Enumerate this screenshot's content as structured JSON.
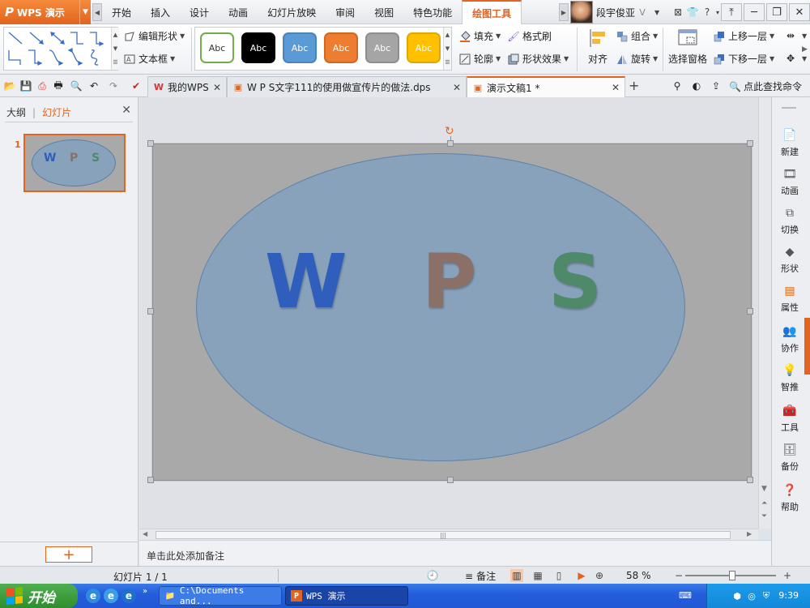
{
  "app": {
    "name": "WPS 演示",
    "logo_glyph": "P"
  },
  "menu": {
    "tabs": [
      "开始",
      "插入",
      "设计",
      "动画",
      "幻灯片放映",
      "审阅",
      "视图",
      "特色功能",
      "绘图工具"
    ],
    "active_tab": "绘图工具"
  },
  "user": {
    "name": "段宇俊亚"
  },
  "ribbon": {
    "edit_shape": "编辑形状",
    "text_box": "文本框",
    "styles": [
      {
        "label": "Abc",
        "bg": "#ffffff",
        "border": "#70ad47",
        "color": "#333333"
      },
      {
        "label": "Abc",
        "bg": "#000000",
        "border": "#000000",
        "color": "#ffffff"
      },
      {
        "label": "Abc",
        "bg": "#5b9bd5",
        "border": "#4a84b8",
        "color": "#ffffff"
      },
      {
        "label": "Abc",
        "bg": "#ed7d31",
        "border": "#d0691f",
        "color": "#ffffff"
      },
      {
        "label": "Abc",
        "bg": "#a5a5a5",
        "border": "#8e8e8e",
        "color": "#ffffff"
      },
      {
        "label": "Abc",
        "bg": "#ffc000",
        "border": "#e0a800",
        "color": "#ffffff"
      }
    ],
    "fill": "填充",
    "format_painter": "格式刷",
    "outline": "轮廓",
    "shape_effects": "形状效果",
    "align": "对齐",
    "group": "组合",
    "rotate": "旋转",
    "selection_pane": "选择窗格",
    "bring_forward": "上移一层",
    "send_backward": "下移一层"
  },
  "doc_tabs": [
    {
      "label": "我的WPS",
      "active": false
    },
    {
      "label": "W P S文字111的使用做宣传片的做法.dps",
      "active": false
    },
    {
      "label": "演示文稿1 *",
      "active": true
    }
  ],
  "command_search": "点此查找命令",
  "left_panel": {
    "outline_tab": "大纲",
    "slides_tab": "幻灯片",
    "slide_number": "1",
    "add_slide": "+"
  },
  "slide": {
    "letters": [
      {
        "char": "W",
        "color": "#2f5ebc"
      },
      {
        "char": "P",
        "color": "#8a7066"
      },
      {
        "char": "S",
        "color": "#4e8a6a"
      }
    ],
    "background": "#a9a9a9",
    "ellipse_fill": "#88a2bc",
    "ellipse_border": "#5b82ad"
  },
  "notes_placeholder": "单击此处添加备注",
  "right_sidebar": [
    "新建",
    "动画",
    "切换",
    "形状",
    "属性",
    "协作",
    "智推",
    "工具",
    "备份",
    "帮助"
  ],
  "status": {
    "slide_counter": "幻灯片 1 / 1",
    "notes_label": "备注",
    "zoom": "58 %"
  },
  "taskbar": {
    "start": "开始",
    "tasks": [
      "C:\\Documents and...",
      "WPS 演示"
    ],
    "time": "9:39"
  },
  "colors": {
    "accent": "#e2641e",
    "taskbar": "#245edb"
  }
}
